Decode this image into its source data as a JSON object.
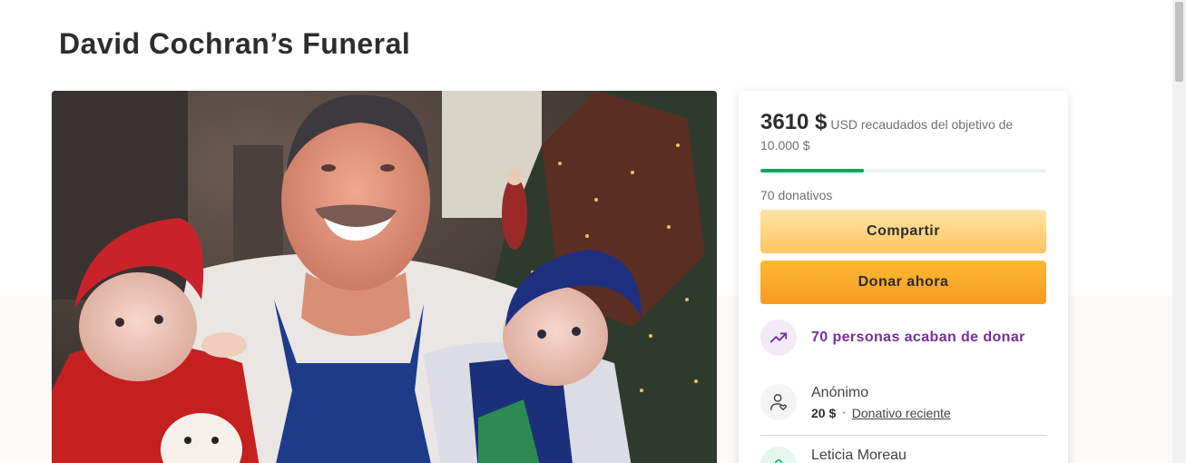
{
  "page": {
    "title": "David Cochran’s Funeral"
  },
  "fundraiser": {
    "amount_raised": "3610 $",
    "goal_text": "USD recaudados del objetivo de 10.000 $",
    "progress_fraction": 0.361,
    "donations_count": "70 donativos",
    "share_label": "Compartir",
    "donate_label": "Donar ahora",
    "recent_activity": "70 personas acaban de donar"
  },
  "donors": [
    {
      "name": "Anónimo",
      "amount": "20 $",
      "tag": "Donativo reciente"
    },
    {
      "name": "Leticia Moreau"
    }
  ],
  "colors": {
    "progress": "#02a95c",
    "share_button": "#fdc464",
    "donate_button": "#f79b24",
    "activity_text": "#7a2c9e"
  },
  "icons": {
    "trend": "trending-up-icon",
    "donor": "heart-user-icon",
    "donor_2": "location-pin-icon"
  }
}
